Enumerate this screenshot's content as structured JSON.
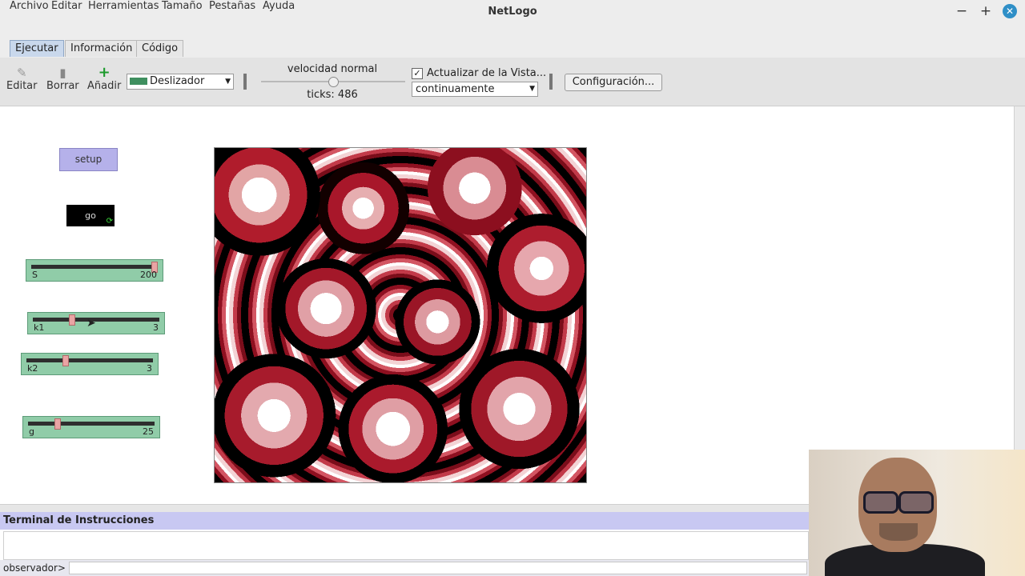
{
  "window": {
    "title": "NetLogo",
    "minimize": "−",
    "maximize": "+",
    "close": "✕"
  },
  "menu": [
    "Archivo",
    "Editar",
    "Herramientas",
    "Tamaño",
    "Pestañas",
    "Ayuda"
  ],
  "tabs": [
    {
      "label": "Ejecutar",
      "active": true
    },
    {
      "label": "Información",
      "active": false
    },
    {
      "label": "Código",
      "active": false
    }
  ],
  "toolbar": {
    "edit_label": "Editar",
    "delete_label": "Borrar",
    "add_label": "Añadir",
    "widget_type": "Deslizador",
    "speed_label": "velocidad normal",
    "speed_value": 0.5,
    "ticks_text": "ticks: 486",
    "update_view_label": "Actualizar de la Vista...",
    "update_view_checked": true,
    "update_mode": "continuamente",
    "settings_label": "Configuración..."
  },
  "widgets": {
    "setup_label": "setup",
    "go_label": "go",
    "sliders": [
      {
        "name": "S",
        "value": "200",
        "fraction": 1.0
      },
      {
        "name": "k1",
        "value": "3",
        "fraction": 0.3
      },
      {
        "name": "k2",
        "value": "3",
        "fraction": 0.3
      },
      {
        "name": "g",
        "value": "25",
        "fraction": 0.22
      }
    ]
  },
  "colors": {
    "view_primary": "#b01c2c",
    "button_setup": "#b5b1ea",
    "slider": "#90cca8",
    "command_header": "#c8c8f2"
  },
  "command_center": {
    "title": "Terminal de Instrucciones",
    "prompt": "observador>",
    "input_value": ""
  }
}
